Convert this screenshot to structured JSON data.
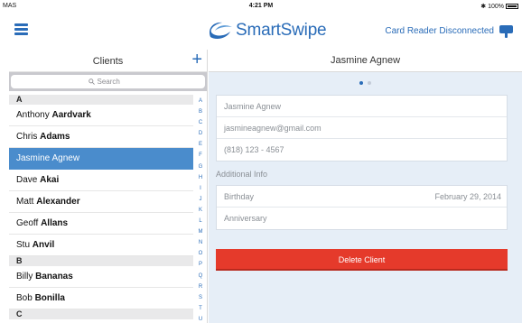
{
  "status_bar": {
    "carrier": "MAS",
    "time": "4:21 PM",
    "battery": "100%"
  },
  "header": {
    "logo_text": "SmartSwipe",
    "card_reader_status": "Card Reader Disconnected",
    "brand_color": "#2a6cb8"
  },
  "clients_panel": {
    "title": "Clients",
    "add_label": "+",
    "search_placeholder": "Search",
    "sections": [
      {
        "letter": "A",
        "clients": [
          {
            "first": "Anthony",
            "last": "Aardvark",
            "selected": false
          },
          {
            "first": "Chris",
            "last": "Adams",
            "selected": false
          },
          {
            "first": "Jasmine",
            "last": "Agnew",
            "selected": true
          },
          {
            "first": "Dave",
            "last": "Akai",
            "selected": false
          },
          {
            "first": "Matt",
            "last": "Alexander",
            "selected": false
          },
          {
            "first": "Geoff",
            "last": "Allans",
            "selected": false
          },
          {
            "first": "Stu",
            "last": "Anvil",
            "selected": false
          }
        ]
      },
      {
        "letter": "B",
        "clients": [
          {
            "first": "Billy",
            "last": "Bananas",
            "selected": false
          },
          {
            "first": "Bob",
            "last": "Bonilla",
            "selected": false
          }
        ]
      },
      {
        "letter": "C",
        "clients": []
      }
    ],
    "index_letters": [
      "A",
      "B",
      "C",
      "D",
      "E",
      "F",
      "G",
      "H",
      "I",
      "J",
      "K",
      "L",
      "M",
      "N",
      "O",
      "P",
      "Q",
      "R",
      "S",
      "T",
      "U"
    ]
  },
  "detail_panel": {
    "title": "Jasmine Agnew",
    "page_dots": {
      "count": 2,
      "active": 0
    },
    "contact": {
      "name": "Jasmine Agnew",
      "email": "jasmineagnew@gmail.com",
      "phone": "(818) 123 - 4567"
    },
    "additional_info_label": "Additional Info",
    "birthday_label": "Birthday",
    "birthday_value": "February 29, 2014",
    "anniversary_label": "Anniversary",
    "delete_label": "Delete Client",
    "delete_color": "#e53a2b"
  }
}
